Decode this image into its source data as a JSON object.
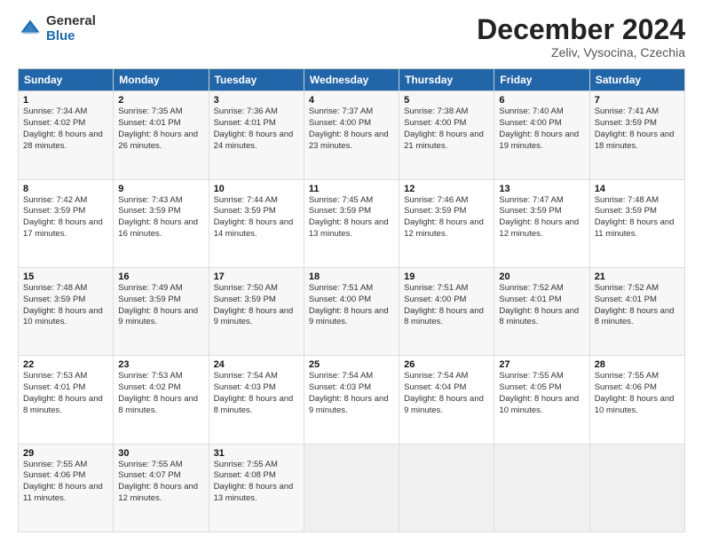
{
  "logo": {
    "general": "General",
    "blue": "Blue"
  },
  "header": {
    "month": "December 2024",
    "location": "Zeliv, Vysocina, Czechia"
  },
  "weekdays": [
    "Sunday",
    "Monday",
    "Tuesday",
    "Wednesday",
    "Thursday",
    "Friday",
    "Saturday"
  ],
  "weeks": [
    [
      {
        "day": "1",
        "sunrise": "7:34 AM",
        "sunset": "4:02 PM",
        "daylight": "8 hours and 28 minutes."
      },
      {
        "day": "2",
        "sunrise": "7:35 AM",
        "sunset": "4:01 PM",
        "daylight": "8 hours and 26 minutes."
      },
      {
        "day": "3",
        "sunrise": "7:36 AM",
        "sunset": "4:01 PM",
        "daylight": "8 hours and 24 minutes."
      },
      {
        "day": "4",
        "sunrise": "7:37 AM",
        "sunset": "4:00 PM",
        "daylight": "8 hours and 23 minutes."
      },
      {
        "day": "5",
        "sunrise": "7:38 AM",
        "sunset": "4:00 PM",
        "daylight": "8 hours and 21 minutes."
      },
      {
        "day": "6",
        "sunrise": "7:40 AM",
        "sunset": "4:00 PM",
        "daylight": "8 hours and 19 minutes."
      },
      {
        "day": "7",
        "sunrise": "7:41 AM",
        "sunset": "3:59 PM",
        "daylight": "8 hours and 18 minutes."
      }
    ],
    [
      {
        "day": "8",
        "sunrise": "7:42 AM",
        "sunset": "3:59 PM",
        "daylight": "8 hours and 17 minutes."
      },
      {
        "day": "9",
        "sunrise": "7:43 AM",
        "sunset": "3:59 PM",
        "daylight": "8 hours and 16 minutes."
      },
      {
        "day": "10",
        "sunrise": "7:44 AM",
        "sunset": "3:59 PM",
        "daylight": "8 hours and 14 minutes."
      },
      {
        "day": "11",
        "sunrise": "7:45 AM",
        "sunset": "3:59 PM",
        "daylight": "8 hours and 13 minutes."
      },
      {
        "day": "12",
        "sunrise": "7:46 AM",
        "sunset": "3:59 PM",
        "daylight": "8 hours and 12 minutes."
      },
      {
        "day": "13",
        "sunrise": "7:47 AM",
        "sunset": "3:59 PM",
        "daylight": "8 hours and 12 minutes."
      },
      {
        "day": "14",
        "sunrise": "7:48 AM",
        "sunset": "3:59 PM",
        "daylight": "8 hours and 11 minutes."
      }
    ],
    [
      {
        "day": "15",
        "sunrise": "7:48 AM",
        "sunset": "3:59 PM",
        "daylight": "8 hours and 10 minutes."
      },
      {
        "day": "16",
        "sunrise": "7:49 AM",
        "sunset": "3:59 PM",
        "daylight": "8 hours and 9 minutes."
      },
      {
        "day": "17",
        "sunrise": "7:50 AM",
        "sunset": "3:59 PM",
        "daylight": "8 hours and 9 minutes."
      },
      {
        "day": "18",
        "sunrise": "7:51 AM",
        "sunset": "4:00 PM",
        "daylight": "8 hours and 9 minutes."
      },
      {
        "day": "19",
        "sunrise": "7:51 AM",
        "sunset": "4:00 PM",
        "daylight": "8 hours and 8 minutes."
      },
      {
        "day": "20",
        "sunrise": "7:52 AM",
        "sunset": "4:01 PM",
        "daylight": "8 hours and 8 minutes."
      },
      {
        "day": "21",
        "sunrise": "7:52 AM",
        "sunset": "4:01 PM",
        "daylight": "8 hours and 8 minutes."
      }
    ],
    [
      {
        "day": "22",
        "sunrise": "7:53 AM",
        "sunset": "4:01 PM",
        "daylight": "8 hours and 8 minutes."
      },
      {
        "day": "23",
        "sunrise": "7:53 AM",
        "sunset": "4:02 PM",
        "daylight": "8 hours and 8 minutes."
      },
      {
        "day": "24",
        "sunrise": "7:54 AM",
        "sunset": "4:03 PM",
        "daylight": "8 hours and 8 minutes."
      },
      {
        "day": "25",
        "sunrise": "7:54 AM",
        "sunset": "4:03 PM",
        "daylight": "8 hours and 9 minutes."
      },
      {
        "day": "26",
        "sunrise": "7:54 AM",
        "sunset": "4:04 PM",
        "daylight": "8 hours and 9 minutes."
      },
      {
        "day": "27",
        "sunrise": "7:55 AM",
        "sunset": "4:05 PM",
        "daylight": "8 hours and 10 minutes."
      },
      {
        "day": "28",
        "sunrise": "7:55 AM",
        "sunset": "4:06 PM",
        "daylight": "8 hours and 10 minutes."
      }
    ],
    [
      {
        "day": "29",
        "sunrise": "7:55 AM",
        "sunset": "4:06 PM",
        "daylight": "8 hours and 11 minutes."
      },
      {
        "day": "30",
        "sunrise": "7:55 AM",
        "sunset": "4:07 PM",
        "daylight": "8 hours and 12 minutes."
      },
      {
        "day": "31",
        "sunrise": "7:55 AM",
        "sunset": "4:08 PM",
        "daylight": "8 hours and 13 minutes."
      },
      null,
      null,
      null,
      null
    ]
  ]
}
